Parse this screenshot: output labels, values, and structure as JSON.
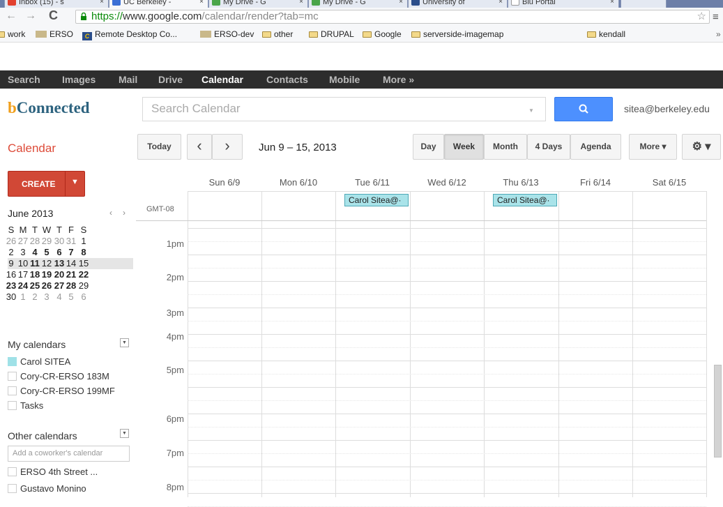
{
  "browser": {
    "tabs": [
      {
        "label": "Inbox (15) - s",
        "icon_color": "#e2412f"
      },
      {
        "label": "UC Berkeley -",
        "icon_color": "#3b6fd5"
      },
      {
        "label": "My Drive - G",
        "icon_color": "#4aa54a"
      },
      {
        "label": "My Drive - G",
        "icon_color": "#4aa54a"
      },
      {
        "label": "University of",
        "icon_color": "#2a4d8a"
      },
      {
        "label": "Blu Portal",
        "icon_color": "#ffffff"
      }
    ],
    "url_scheme": "https://",
    "url_host": "www.google.com",
    "url_path": "/calendar/render?tab=mc",
    "bookmarks": [
      "work",
      "ERSO",
      "Remote Desktop Co...",
      "ERSO-dev",
      "other",
      "DRUPAL",
      "Google",
      "serverside-imagemap",
      "kendall"
    ],
    "bookmarks_overflow": "»"
  },
  "googlebar": {
    "items": [
      "Search",
      "Images",
      "Mail",
      "Drive",
      "Calendar",
      "Contacts",
      "Mobile",
      "More »"
    ],
    "active": "Calendar"
  },
  "header": {
    "logo_b": "b",
    "logo_rest": "Connected",
    "search_placeholder": "Search Calendar",
    "user_email": "sitea@berkeley.edu"
  },
  "toolbar": {
    "title": "Calendar",
    "today": "Today",
    "prev": "‹",
    "next": "›",
    "date_range": "Jun 9 – 15, 2013",
    "views": [
      "Day",
      "Week",
      "Month",
      "4 Days",
      "Agenda"
    ],
    "active_view": "Week",
    "more": "More ▾",
    "settings": "⚙ ▾"
  },
  "sidebar": {
    "create_label": "CREATE",
    "mini_month": "June 2013",
    "weekdays": [
      "S",
      "M",
      "T",
      "W",
      "T",
      "F",
      "S"
    ],
    "weeks": [
      [
        "26",
        "27",
        "28",
        "29",
        "30",
        "31",
        "1"
      ],
      [
        "2",
        "3",
        "4",
        "5",
        "6",
        "7",
        "8"
      ],
      [
        "9",
        "10",
        "11",
        "12",
        "13",
        "14",
        "15"
      ],
      [
        "16",
        "17",
        "18",
        "19",
        "20",
        "21",
        "22"
      ],
      [
        "23",
        "24",
        "25",
        "26",
        "27",
        "28",
        "29"
      ],
      [
        "30",
        "1",
        "2",
        "3",
        "4",
        "5",
        "6"
      ]
    ],
    "my_calendars_title": "My calendars",
    "my_calendars": [
      {
        "name": "Carol SITEA",
        "color": "#9fe1e7"
      },
      {
        "name": "Cory-CR-ERSO 183M",
        "color": "#ffffff"
      },
      {
        "name": "Cory-CR-ERSO 199MF",
        "color": "#ffffff"
      },
      {
        "name": "Tasks",
        "color": "#ffffff"
      }
    ],
    "other_calendars_title": "Other calendars",
    "coworker_placeholder": "Add a coworker's calendar",
    "other_calendars": [
      {
        "name": "ERSO 4th Street ...",
        "color": "#ffffff"
      },
      {
        "name": "Gustavo Monino",
        "color": "#ffffff"
      }
    ]
  },
  "week": {
    "timezone": "GMT-08",
    "days": [
      "Sun 6/9",
      "Mon 6/10",
      "Tue 6/11",
      "Wed 6/12",
      "Thu 6/13",
      "Fri 6/14",
      "Sat 6/15"
    ],
    "hours": [
      "1pm",
      "2pm",
      "3pm",
      "4pm",
      "5pm",
      "6pm",
      "7pm",
      "8pm"
    ],
    "events": [
      {
        "day": 2,
        "title": "Carol Sitea@·"
      },
      {
        "day": 4,
        "title": "Carol Sitea@·"
      }
    ],
    "event_color": "#a9e3e9"
  }
}
